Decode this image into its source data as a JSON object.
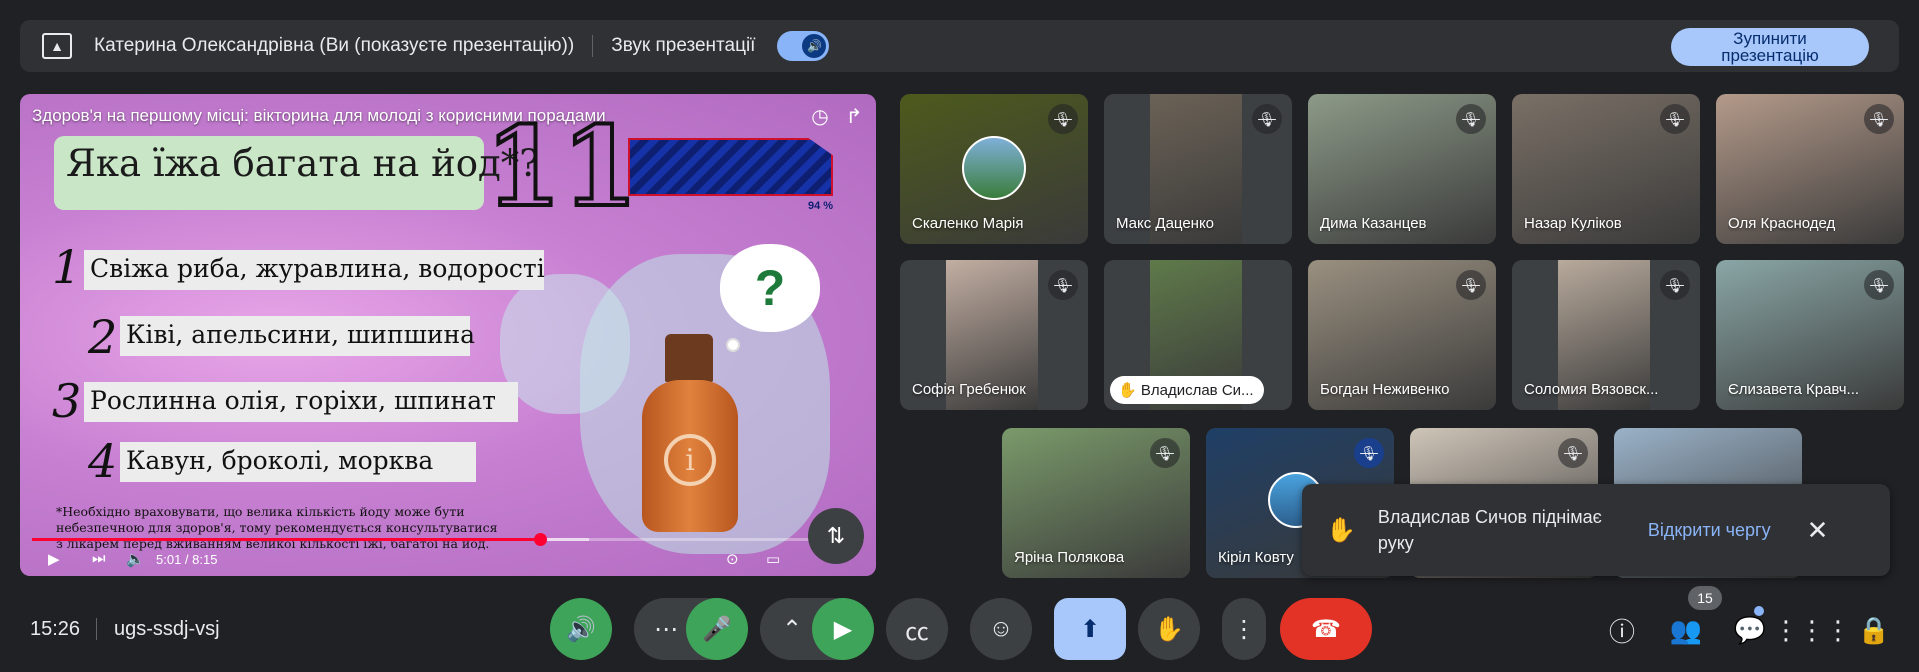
{
  "topbar": {
    "presenter": "Катерина Олександрівна (Ви (показуєте презентацію))",
    "sound_label": "Звук презентації",
    "stop_button": "Зупинити презентацію"
  },
  "video": {
    "title": "Здоров'я на першому місці: вікторина для молоді з корисними порадами",
    "time": "5:01 / 8:15",
    "progress_fraction": 0.61,
    "slide": {
      "question": "Яка їжа багата на йод*?",
      "big_number": "11",
      "timer_percent": "94 %",
      "timer_fraction": 0.94,
      "answers": [
        {
          "num": "1",
          "text": "Свіжа риба, журавлина, водорості"
        },
        {
          "num": "2",
          "text": "Ківі, апельсини, шипшина"
        },
        {
          "num": "3",
          "text": "Рослинна олія, горіхи, шпинат"
        },
        {
          "num": "4",
          "text": "Кавун, броколі, морква"
        }
      ],
      "footnote": "*Необхідно враховувати, що велика кількість йоду може бути небезпечною для здоров'я, тому рекомендується консультуватися з лікарем перед вживанням великої кількості їжі, багатої на йод."
    }
  },
  "participants": [
    {
      "name": "Скаленко Марія",
      "bg": "#4d5a1c"
    },
    {
      "name": "Макс Даценко",
      "bg": "#6b6256"
    },
    {
      "name": "Дима Казанцев",
      "bg": "#8d9a88"
    },
    {
      "name": "Назар Куліков",
      "bg": "#7a7066"
    },
    {
      "name": "Оля Краснодед",
      "bg": "#b49a8a"
    },
    {
      "name": "Софія Гребенюк",
      "bg": "#c2aea2"
    },
    {
      "name": "Владислав Си...",
      "bg": "#5f7a4a"
    },
    {
      "name": "Богдан Неживенко",
      "bg": "#9a9080"
    },
    {
      "name": "Соломия Вязовск...",
      "bg": "#b8aa9c"
    },
    {
      "name": "Єлизавета Кравч...",
      "bg": "#8aa6a6"
    },
    {
      "name": "Яріна Полякова",
      "bg": "#7a9a6a"
    },
    {
      "name": "Кіріл Ковту",
      "bg": "#1f3f66"
    },
    {
      "name": "",
      "bg": "#cfc5b8"
    },
    {
      "name": "",
      "bg": "#9ab2c8"
    }
  ],
  "notification": {
    "message": "Владислав Сичов піднімає руку",
    "action": "Відкрити чергу"
  },
  "bottom": {
    "time": "15:26",
    "meeting_code": "ugs-ssdj-vsj",
    "participants_count": "15"
  }
}
